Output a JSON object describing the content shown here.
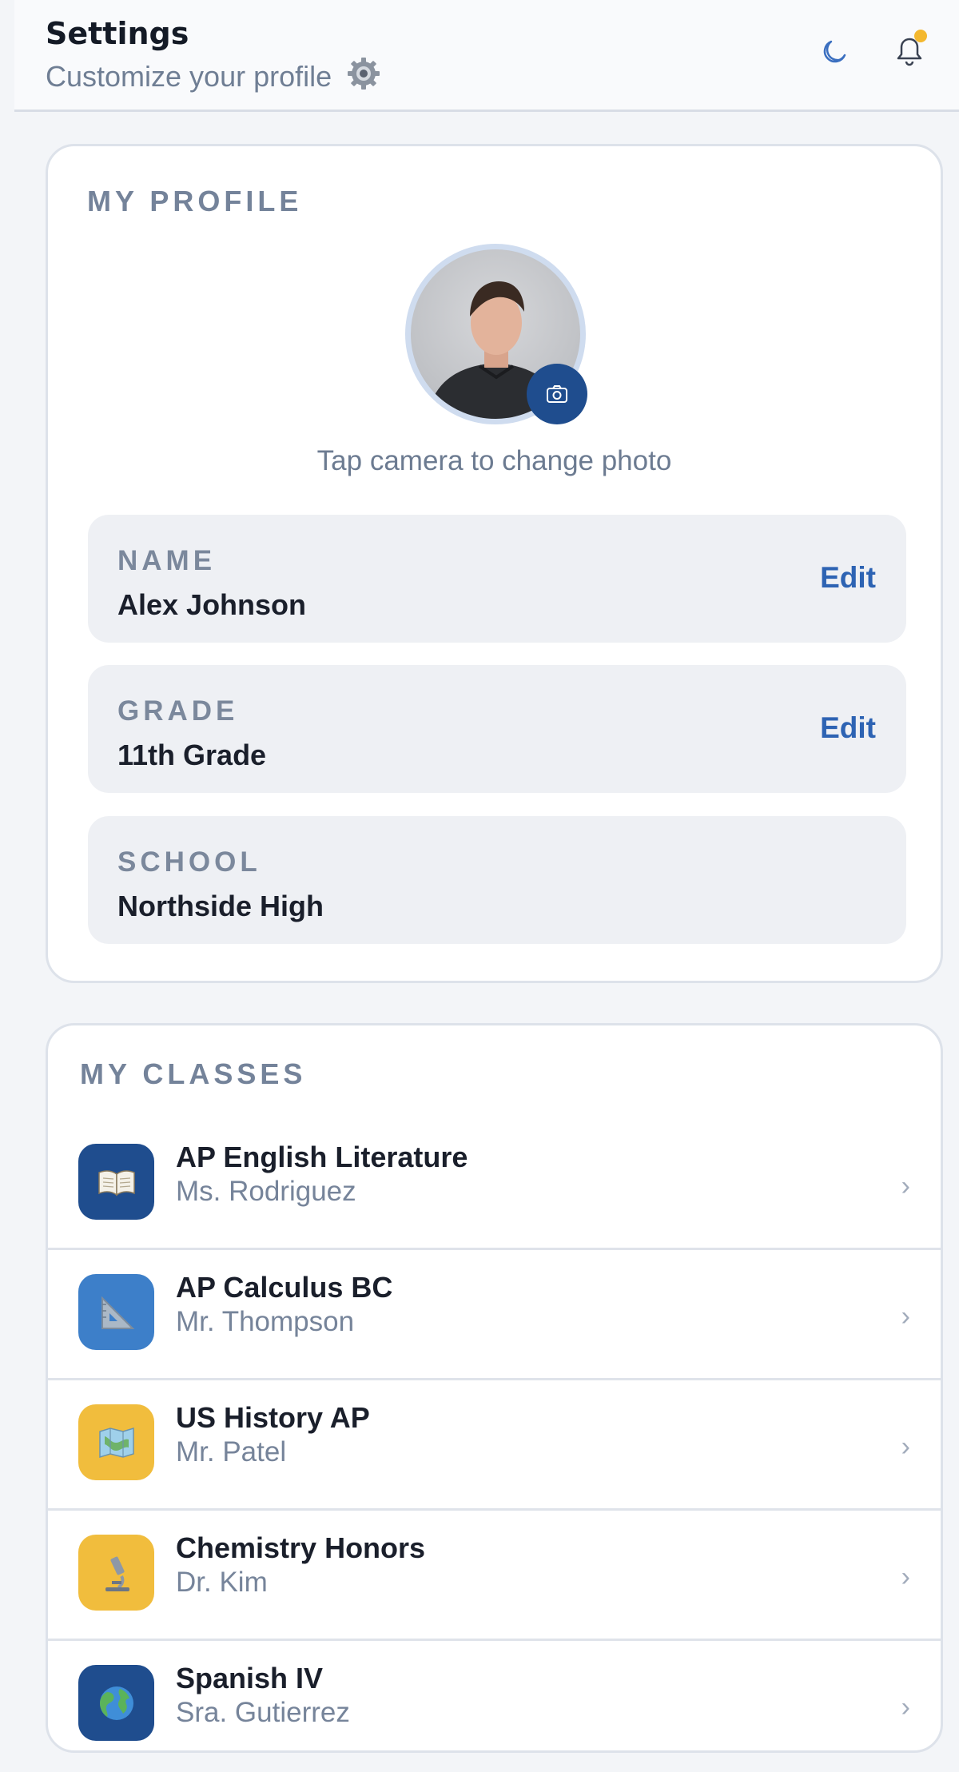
{
  "header": {
    "title": "Settings",
    "subtitle": "Customize your profile"
  },
  "profile": {
    "section_title": "MY PROFILE",
    "photo_hint": "Tap camera to change photo",
    "fields": [
      {
        "label": "NAME",
        "value": "Alex Johnson",
        "action": "Edit"
      },
      {
        "label": "GRADE",
        "value": "11th Grade",
        "action": "Edit"
      },
      {
        "label": "SCHOOL",
        "value": "Northside High"
      }
    ]
  },
  "classes": {
    "section_title": "MY CLASSES",
    "items": [
      {
        "name": "AP English Literature",
        "teacher": "Ms. Rodriguez",
        "icon": "book-icon",
        "color": "#1f4d8e"
      },
      {
        "name": "AP Calculus BC",
        "teacher": "Mr. Thompson",
        "icon": "triangle-ruler-icon",
        "color": "#3d7fc9"
      },
      {
        "name": "US History AP",
        "teacher": "Mr. Patel",
        "icon": "map-icon",
        "color": "#f1bd3d"
      },
      {
        "name": "Chemistry Honors",
        "teacher": "Dr. Kim",
        "icon": "microscope-icon",
        "color": "#f1bd3d"
      },
      {
        "name": "Spanish IV",
        "teacher": "Sra. Gutierrez",
        "icon": "globe-icon",
        "color": "#1f4d8e"
      }
    ]
  },
  "colors": {
    "accent": "#2d63b3",
    "camera_button": "#1f4d8e",
    "notification_dot": "#f4b82f"
  }
}
